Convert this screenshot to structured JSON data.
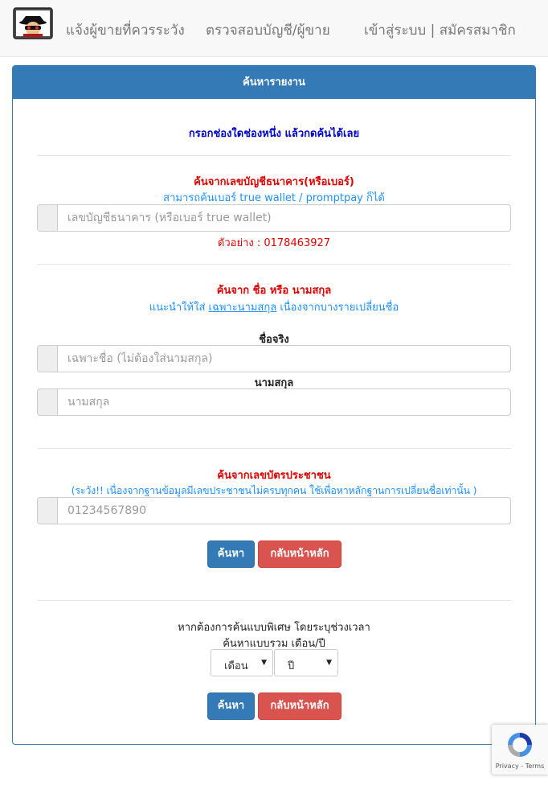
{
  "nav": {
    "report_label": "แจ้งผู้ขายที่ควรระวัง",
    "check_label": "ตรวจสอบบัญชี/ผู้ขาย",
    "login_register_label": "เข้าสู่ระบบ | สมัครสมาชิก"
  },
  "panel": {
    "title": "ค้นหารายงาน",
    "hint": "กรอกช่องใดช่องหนึ่ง แล้วกดค้นได้เลย"
  },
  "bank_section": {
    "title": "ค้นจากเลขบัญชีธนาคาร(หรือเบอร์)",
    "subtitle": "สามารถค้นเบอร์ true wallet / promptpay ก็ได้",
    "placeholder": "เลขบัญชีธนาคาร (หรือเบอร์ true wallet)",
    "example": "ตัวอย่าง : 0178463927"
  },
  "name_section": {
    "title": "ค้นจาก ชื่อ หรือ นามสกุล",
    "subtitle_pre": "แนะนำให้ใส่ ",
    "subtitle_underline": "เฉพาะนามสกุล",
    "subtitle_post": " เนื่องจากบางรายเปลี่ยนชื่อ",
    "first_name_label": "ชื่อจริง",
    "first_name_placeholder": "เฉพาะชื่อ (ไม่ต้องใส่นามสกุล)",
    "last_name_label": "นามสกุล",
    "last_name_placeholder": "นามสกุล"
  },
  "id_section": {
    "title": "ค้นจากเลขบัตรประชาชน",
    "subtitle": "(ระวัง!! เนื่องจากฐานข้อมูลมีเลขประชาชนไม่ครบทุกคน ใช้เพื่อหาหลักฐานการเปลี่ยนชื่อเท่านั้น )",
    "placeholder": "01234567890"
  },
  "buttons": {
    "search": "ค้นหา",
    "back_home": "กลับหน้าหลัก"
  },
  "advanced": {
    "line1": "หากต้องการค้นแบบพิเศษ โดยระบุช่วงเวลา",
    "line2": "ค้นหาแบบรวม เดือน/ปี",
    "month_selected": "เดือน",
    "year_selected": "ปี"
  },
  "recaptcha": {
    "privacy": "Privacy",
    "separator": " - ",
    "terms": "Terms"
  },
  "colors": {
    "primary": "#337ab7",
    "danger": "#d9534f",
    "title_red": "#e00000",
    "subtitle_blue": "#1e90ff",
    "hint_blue": "#0000cc"
  },
  "icons": {
    "logo": "spy-hacker-logo-icon",
    "recaptcha": "recaptcha-icon",
    "select_caret": "caret-down-icon"
  }
}
